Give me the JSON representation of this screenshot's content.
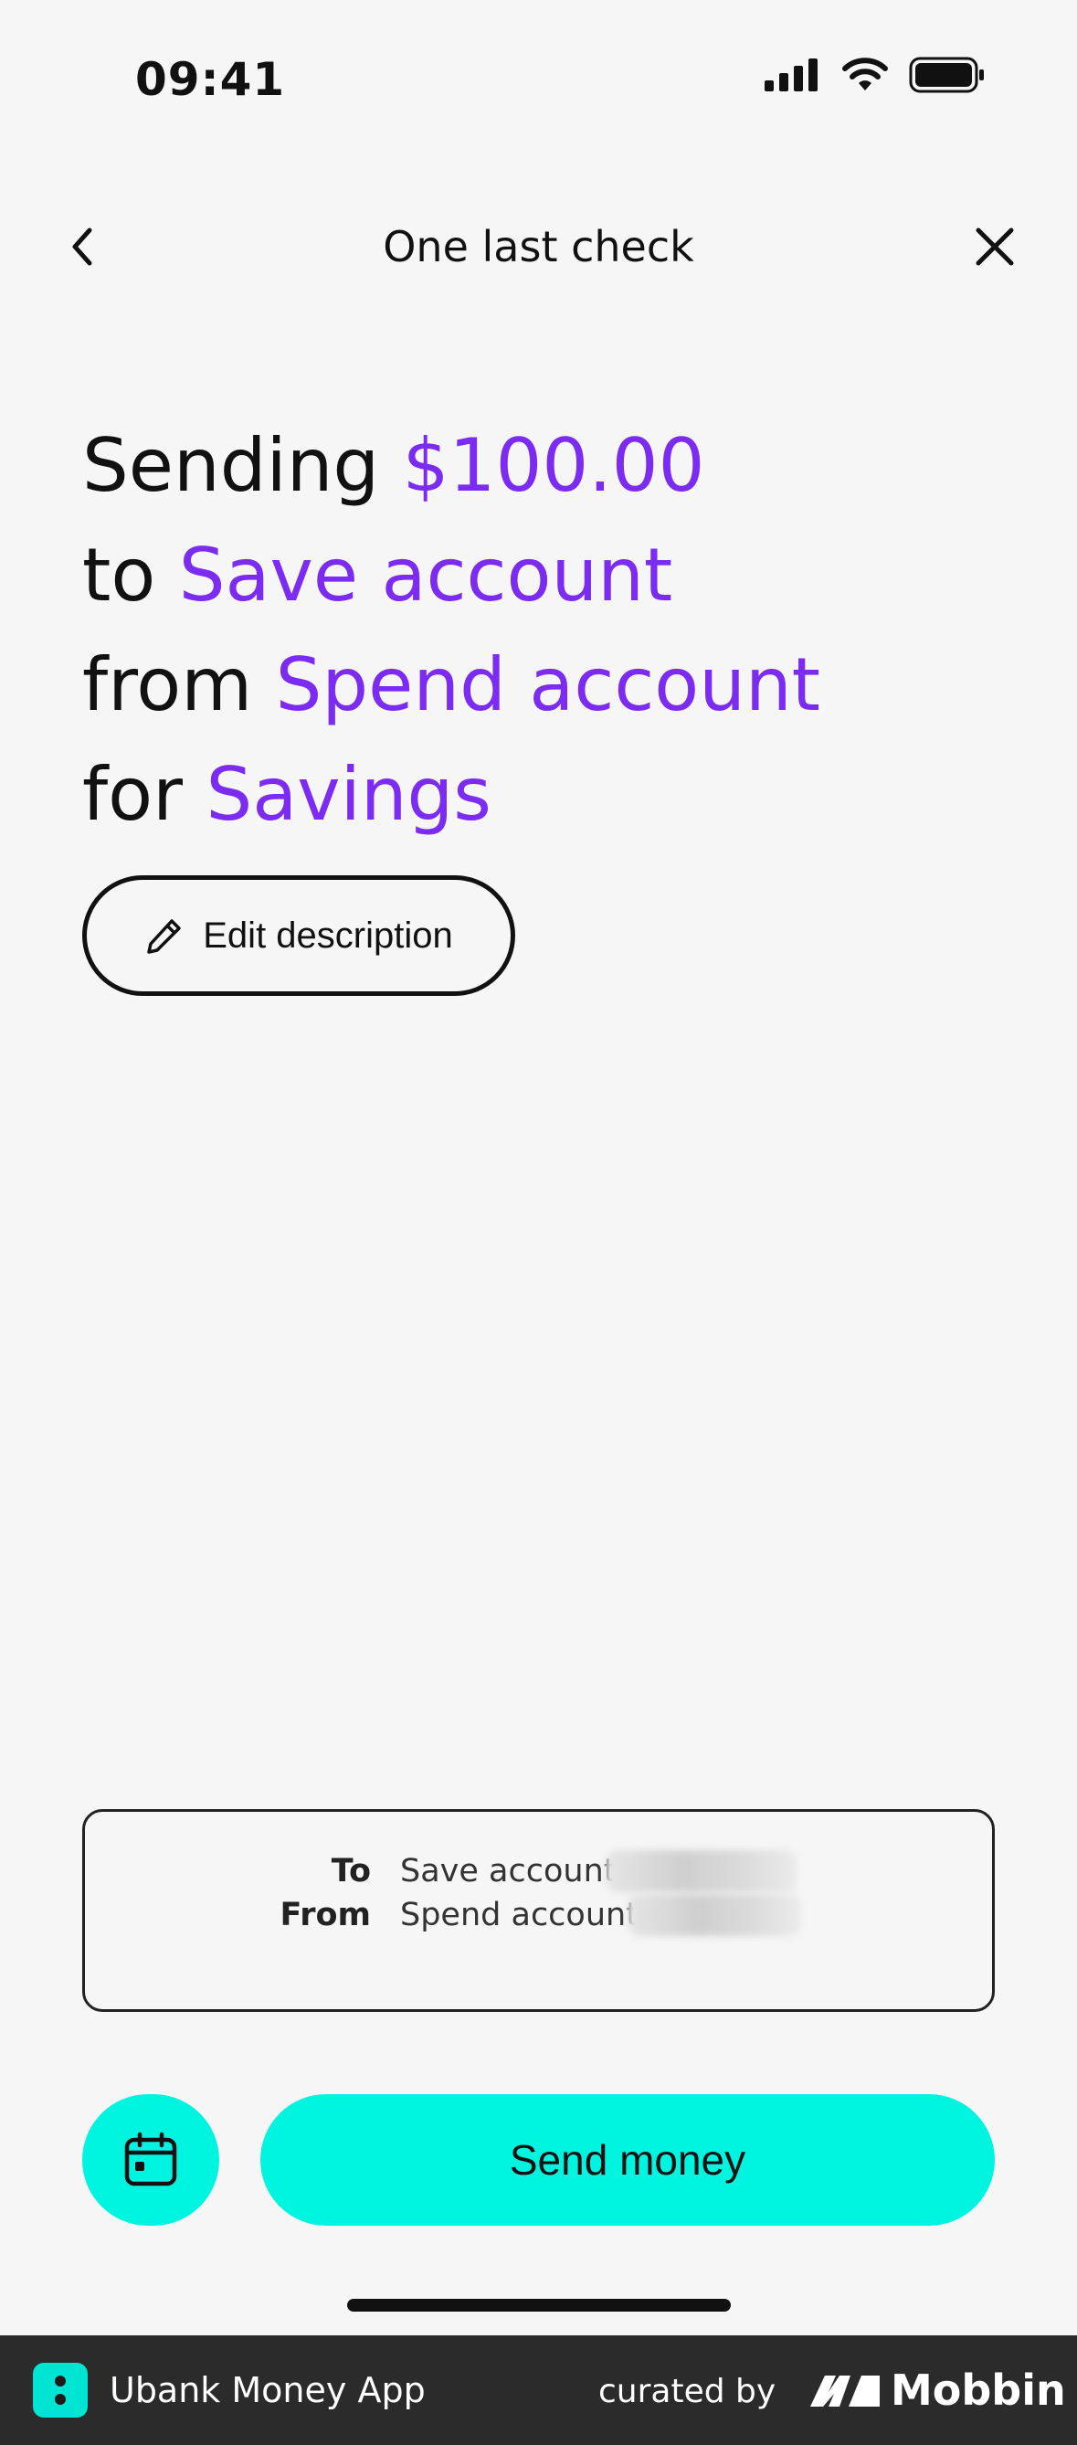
{
  "status_bar": {
    "time": "09:41"
  },
  "header": {
    "title": "One last check"
  },
  "summary": {
    "line1_prefix": "Sending",
    "amount": "$100.00",
    "line2_prefix": "to",
    "to_account": "Save account",
    "line3_prefix": "from",
    "from_account": "Spend account",
    "line4_prefix": "for",
    "description": "Savings"
  },
  "edit_button": {
    "label": "Edit description"
  },
  "details": {
    "to_label": "To",
    "to_value": "Save account",
    "from_label": "From",
    "from_value": "Spend account"
  },
  "actions": {
    "send_label": "Send money"
  },
  "footer": {
    "app_name": "Ubank Money App",
    "curated_by": "curated by",
    "brand": "Mobbin"
  },
  "colors": {
    "accent": "#7b2cf0",
    "button": "#00f5e1",
    "background": "#f6f6f6"
  }
}
